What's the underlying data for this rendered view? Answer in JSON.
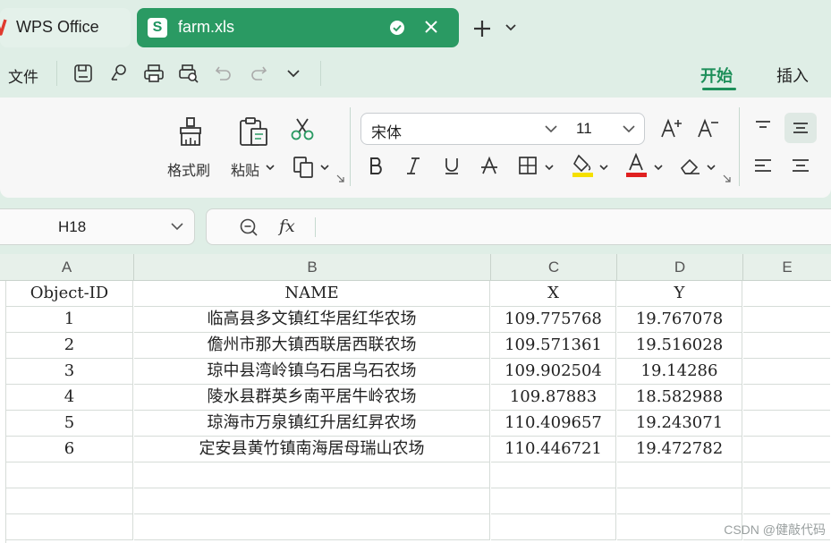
{
  "tabs": [
    {
      "label": "WPS Office",
      "icon": "wps-logo-icon",
      "active": false
    },
    {
      "label": "farm.xls",
      "icon": "spreadsheet-s-icon",
      "active": true
    }
  ],
  "quick_access": {
    "file_label": "文件"
  },
  "ribbon_tabs": [
    {
      "label": "开始",
      "active": true
    },
    {
      "label": "插入",
      "active": false
    }
  ],
  "ribbon": {
    "format_painter_label": "格式刷",
    "paste_label": "粘贴",
    "font_name": "宋体",
    "font_size": "11",
    "font_color": "#e02020",
    "highlight_color": "#f5e000"
  },
  "name_box": {
    "value": "H18"
  },
  "formula_bar": {
    "fx_label": "fx",
    "value": ""
  },
  "sheet": {
    "columns": [
      "A",
      "B",
      "C",
      "D",
      "E"
    ],
    "rows": [
      [
        "Object-ID",
        "NAME",
        "X",
        "Y",
        ""
      ],
      [
        "1",
        "临高县多文镇红华居红华农场",
        "109.775768",
        "19.767078",
        ""
      ],
      [
        "2",
        "儋州市那大镇西联居西联农场",
        "109.571361",
        "19.516028",
        ""
      ],
      [
        "3",
        "琼中县湾岭镇乌石居乌石农场",
        "109.902504",
        "19.14286",
        ""
      ],
      [
        "4",
        "陵水县群英乡南平居牛岭农场",
        "109.87883",
        "18.582988",
        ""
      ],
      [
        "5",
        "琼海市万泉镇红升居红昇农场",
        "110.409657",
        "19.243071",
        ""
      ],
      [
        "6",
        "定安县黄竹镇南海居母瑞山农场",
        "110.446721",
        "19.472782",
        ""
      ],
      [
        "",
        "",
        "",
        "",
        ""
      ],
      [
        "",
        "",
        "",
        "",
        ""
      ],
      [
        "",
        "",
        "",
        "",
        ""
      ]
    ]
  },
  "watermark": "CSDN @健敲代码",
  "colors": {
    "accent": "#2a9a63",
    "window_bg": "#dfeee6"
  }
}
